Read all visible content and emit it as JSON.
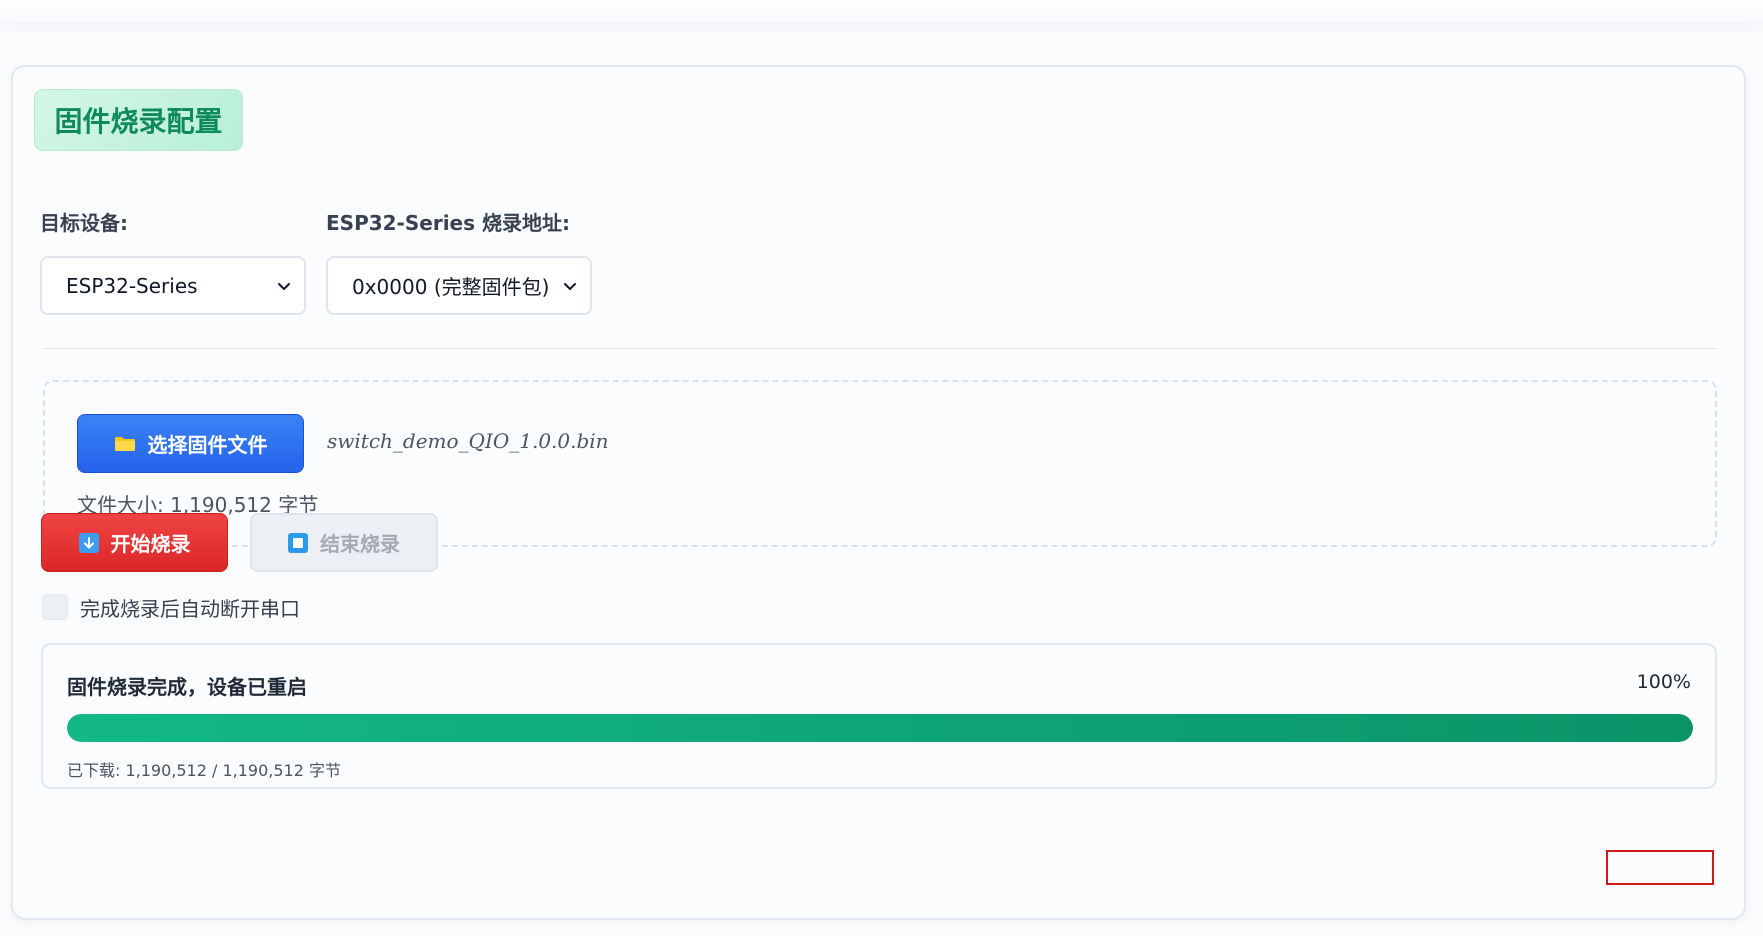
{
  "config": {
    "title": "固件烧录配置",
    "target_device": {
      "label": "目标设备:",
      "selected": "ESP32-Series"
    },
    "flash_address": {
      "label": "ESP32-Series 烧录地址:",
      "selected": "0x0000 (完整固件包)"
    }
  },
  "file": {
    "select_button_label": "选择固件文件",
    "selected_filename": "switch_demo_QIO_1.0.0.bin",
    "size_text": "文件大小: 1,190,512 字节"
  },
  "actions": {
    "start_label": "开始烧录",
    "stop_label": "结束烧录",
    "stop_enabled": false
  },
  "options": {
    "auto_disconnect_label": "完成烧录后自动断开串口",
    "auto_disconnect_checked": false
  },
  "status": {
    "message": "固件烧录完成，设备已重启",
    "percent_text": "100%",
    "progress": 1.0,
    "downloaded_text": "已下载: 1,190,512 / 1,190,512 字节"
  },
  "icons": {
    "folder": "folder-icon",
    "start": "download-arrow-icon",
    "stop": "stop-square-icon",
    "select_chevron": "chevron-down-icon"
  },
  "colors": {
    "accent_green": "#0f8a5f",
    "primary_blue": "#2563eb",
    "danger_red": "#dc2626",
    "progress_green": "#10b981"
  }
}
